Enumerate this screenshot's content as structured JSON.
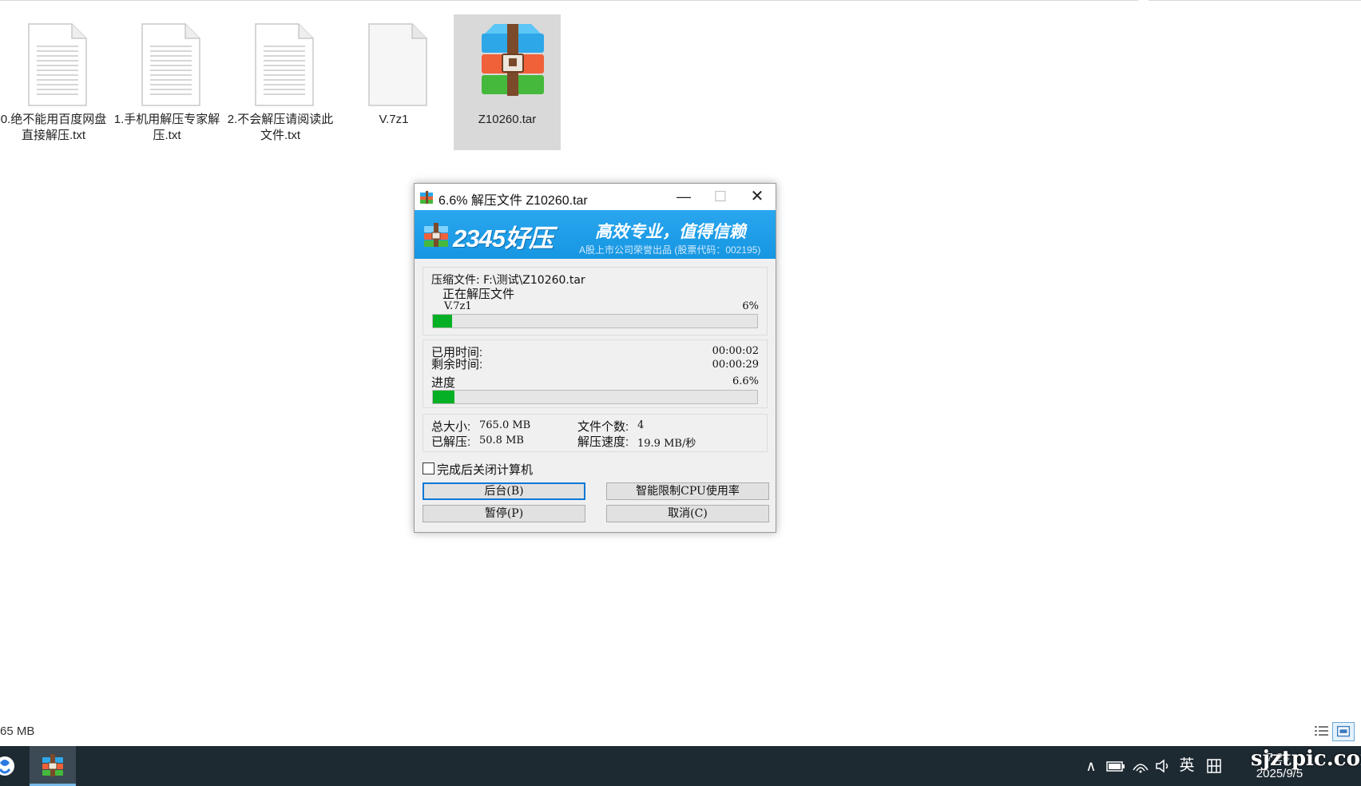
{
  "desktop": {
    "files": [
      {
        "name": "0.绝不能用百度网盘直接解压.txt",
        "type": "text"
      },
      {
        "name": "1.手机用解压专家解压.txt",
        "type": "text"
      },
      {
        "name": "2.不会解压请阅读此文件.txt",
        "type": "text"
      },
      {
        "name": "V.7z1",
        "type": "blank"
      },
      {
        "name": "Z10260.tar",
        "type": "archive",
        "selected": true
      }
    ],
    "status_size": "65 MB"
  },
  "dialog": {
    "title": "6.6% 解压文件 Z10260.tar",
    "banner": {
      "brand": "2345好压",
      "slogan": "高效专业，值得信赖",
      "subtitle": "A股上市公司荣誉出品 (股票代码：002195)"
    },
    "archive_label": "压缩文件: F:\\测试\\Z10260.tar",
    "extracting_label": "正在解压文件",
    "current_file": "V.7z1",
    "current_file_percent": "6%",
    "file_progress": 0.06,
    "elapsed_label": "已用时间:",
    "elapsed_value": "00:00:02",
    "remaining_label": "剩余时间:",
    "remaining_value": "00:00:29",
    "progress_label": "进度",
    "progress_value": "6.6%",
    "total_progress": 0.066,
    "total_size_label": "总大小:",
    "total_size_value": "765.0 MB",
    "extracted_label": "已解压:",
    "extracted_value": "50.8 MB",
    "file_count_label": "文件个数:",
    "file_count_value": "4",
    "speed_label": "解压速度:",
    "speed_value": "19.9 MB/秒",
    "shutdown_label": "完成后关闭计算机",
    "shutdown_checked": false,
    "buttons": {
      "background": "后台(B)",
      "cpu_limit": "智能限制CPU使用率",
      "pause": "暂停(P)",
      "cancel": "取消(C)"
    }
  },
  "taskbar": {
    "language": "英",
    "time": "7:24",
    "date": "2025/9/5",
    "watermark": "sjztpic.com"
  },
  "colors": {
    "accent": "#0078d7",
    "banner": "#1696e2",
    "progress": "#06b025",
    "taskbar": "#1e2a32"
  },
  "icons": [
    "minimize-icon",
    "maximize-icon",
    "close-icon",
    "chevron-up-icon",
    "battery-icon",
    "wifi-icon",
    "volume-icon",
    "ime-icon"
  ]
}
